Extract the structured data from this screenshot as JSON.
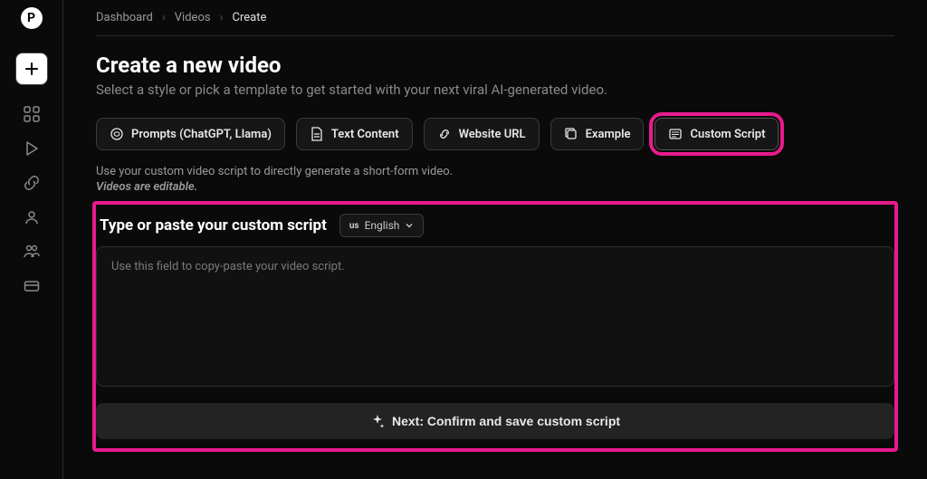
{
  "logo_letter": "P",
  "breadcrumb": {
    "items": [
      "Dashboard",
      "Videos",
      "Create"
    ]
  },
  "title": "Create a new video",
  "subtitle": "Select a style or pick a template to get started with your next viral AI-generated video.",
  "tabs": {
    "prompts": "Prompts (ChatGPT, Llama)",
    "text": "Text Content",
    "url": "Website URL",
    "example": "Example",
    "custom": "Custom Script"
  },
  "description": "Use your custom video script to directly generate a short-form video.",
  "editable_note": "Videos are editable.",
  "script": {
    "heading": "Type or paste your custom script",
    "lang_code": "us",
    "lang_name": "English",
    "placeholder": "Use this field to copy-paste your video script."
  },
  "next_label": "Next: Confirm and save custom script"
}
